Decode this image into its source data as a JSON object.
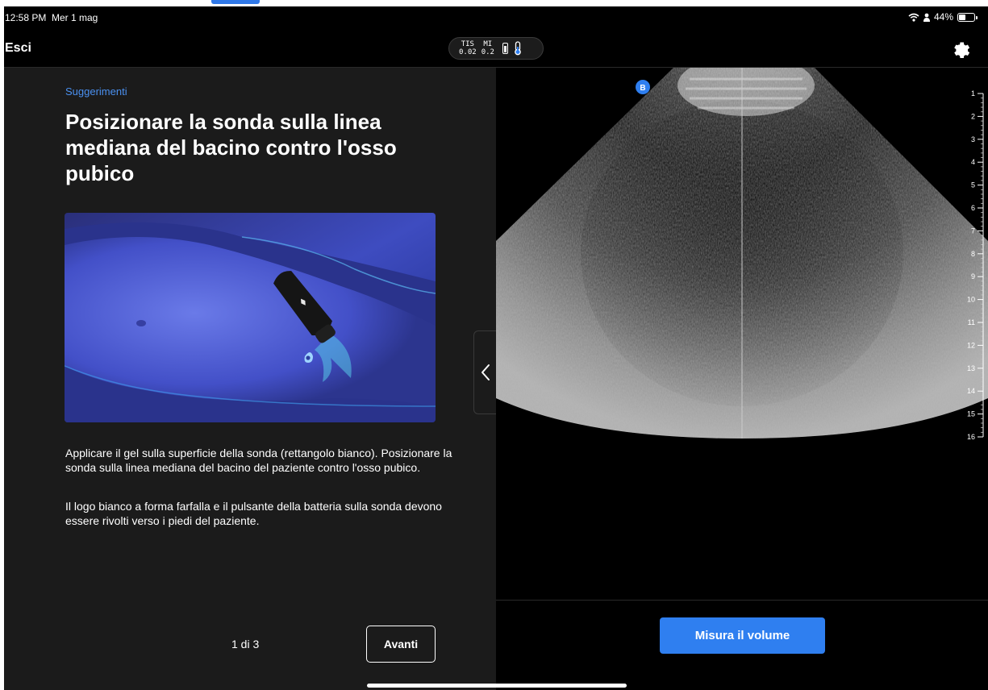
{
  "status_bar": {
    "time": "12:58 PM",
    "date": "Mer 1 mag",
    "battery_percent": "44%",
    "battery_level": 0.44,
    "icons": [
      "wifi-icon",
      "person-icon",
      "battery-icon"
    ]
  },
  "nav": {
    "exit_label": "Esci",
    "tis_label": "TIS",
    "tis_value": "0.02",
    "mi_label": "MI",
    "mi_value": "0.2",
    "probe_battery_icon": "probe-battery-icon",
    "temperature_icon": "thermometer-icon",
    "settings_icon": "gear-icon"
  },
  "guide": {
    "section_label": "Suggerimenti",
    "title": "Posizionare la sonda sulla linea mediana del bacino contro l'osso pubico",
    "paragraph_1": "Applicare il gel sulla superficie della sonda (rettangolo bianco). Posizionare la sonda sulla linea mediana del bacino del paziente contro l'osso pubico.",
    "paragraph_2": "Il logo bianco a forma farfalla e il pulsante della batteria sulla sonda devono essere rivolti verso i piedi del paziente.",
    "page_indicator": "1 di 3",
    "next_label": "Avanti",
    "collapse_icon": "chevron-left-icon"
  },
  "scan": {
    "mode_badge": "B",
    "depth_scale": [
      "1",
      "2",
      "3",
      "4",
      "5",
      "6",
      "7",
      "8",
      "9",
      "10",
      "11",
      "12",
      "13",
      "14",
      "15",
      "16"
    ],
    "measure_label": "Misura il volume"
  },
  "colors": {
    "accent": "#2f7ff0",
    "section_label": "#4a90f0",
    "panel_bg": "#1b1b1b",
    "background": "#000000"
  }
}
